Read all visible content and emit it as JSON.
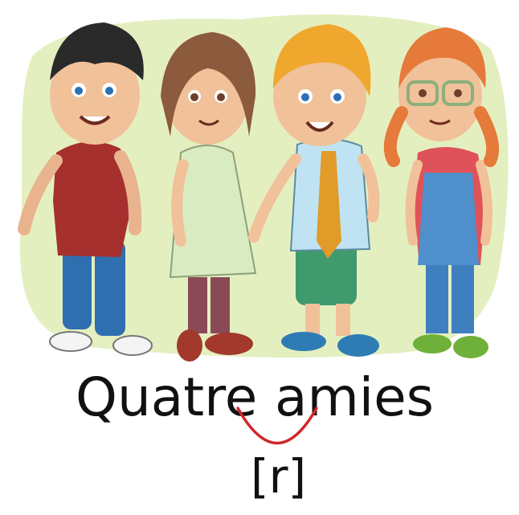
{
  "caption": {
    "word_1": "Quatre",
    "word_2": "amies",
    "phoneme": "[r]"
  },
  "illustration": {
    "subject": "four cartoon children standing together",
    "icon": "children-group-illustration",
    "colors": {
      "background_blob": "#e4efc0",
      "liaison_arc": "#d0262b",
      "text": "#111111"
    }
  }
}
